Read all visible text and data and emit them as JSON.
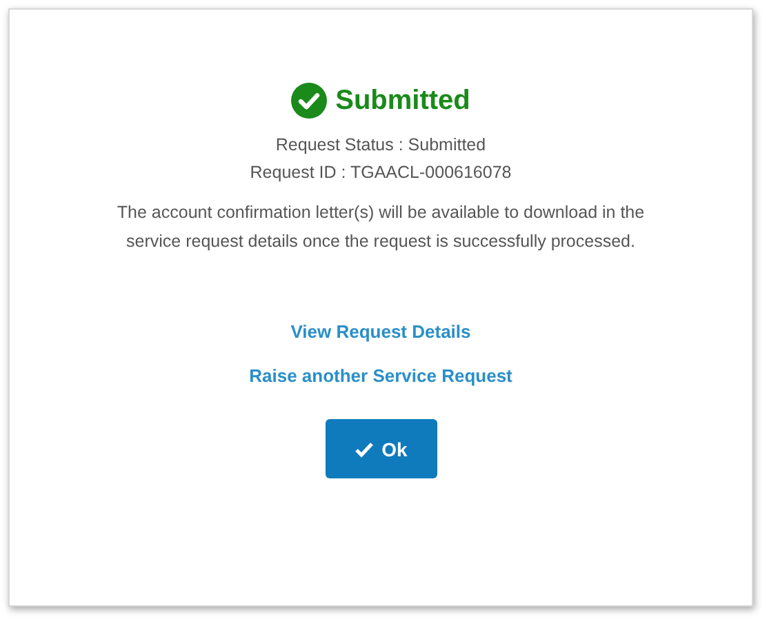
{
  "dialog": {
    "title": "Submitted",
    "status_line": "Request Status :  Submitted",
    "id_line": "Request ID : TGAACL-000616078",
    "message": "The account confirmation letter(s) will be available to download in the service request details once the request is successfully processed.",
    "links": [
      "View Request Details",
      "Raise another Service Request"
    ],
    "button": "Ok"
  }
}
